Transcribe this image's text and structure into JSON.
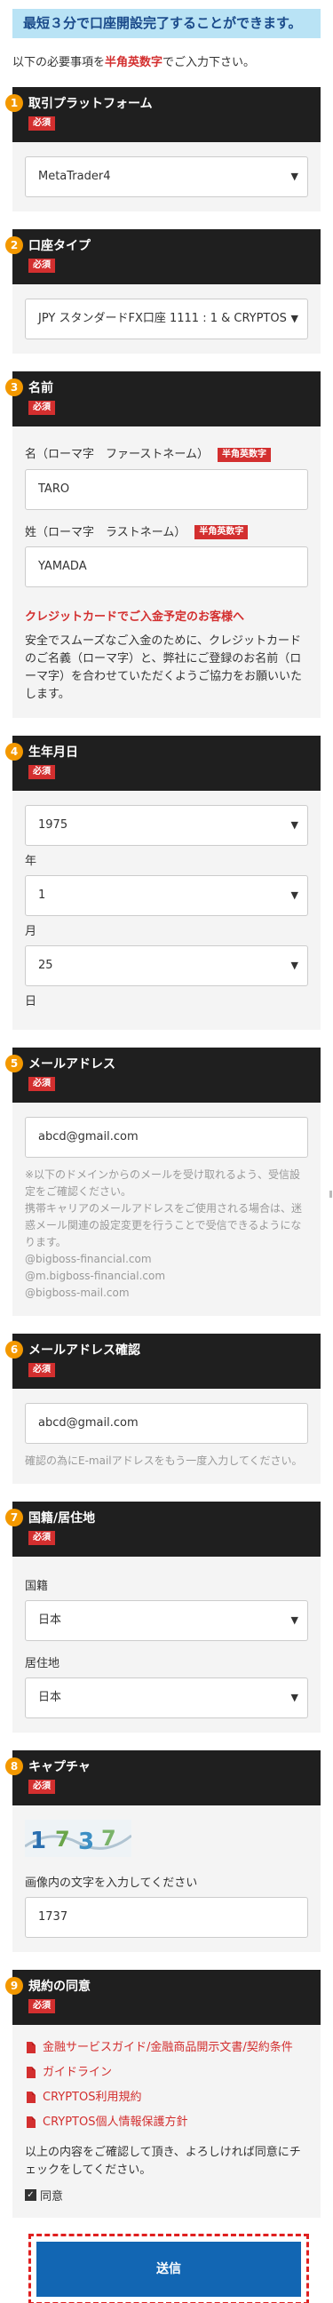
{
  "banner": "最短３分で口座開設完了することができます。",
  "intro": {
    "before": "以下の必要事項を",
    "highlight": "半角英数字",
    "after": "でご入力下さい。"
  },
  "required_label": "必須",
  "alnum_label": "半角英数字",
  "sections": {
    "platform": {
      "num": "1",
      "title": "取引プラットフォーム",
      "value": "MetaTrader4"
    },
    "account_type": {
      "num": "2",
      "title": "口座タイプ",
      "value": "JPY スタンダードFX口座 1111 : 1 & CRYPTOS"
    },
    "name": {
      "num": "3",
      "title": "名前",
      "first_label": "名（ローマ字　ファーストネーム）",
      "first_value": "TARO",
      "last_label": "姓（ローマ字　ラストネーム）",
      "last_value": "YAMADA",
      "card_heading": "クレジットカードでご入金予定のお客様へ",
      "card_note": "安全でスムーズなご入金のために、クレジットカードのご名義（ローマ字）と、弊社にご登録のお名前（ローマ字）を合わせていただくようご協力をお願いいたします。"
    },
    "birthday": {
      "num": "4",
      "title": "生年月日",
      "year": "1975",
      "year_label": "年",
      "month": "1",
      "month_label": "月",
      "day": "25",
      "day_label": "日"
    },
    "email": {
      "num": "5",
      "title": "メールアドレス",
      "value": "abcd@gmail.com",
      "note1": "※以下のドメインからのメールを受け取れるよう、受信設定をご確認ください。",
      "note2": "携帯キャリアのメールアドレスをご使用される場合は、迷惑メール関連の設定変更を行うことで受信できるようになります。",
      "domain1": "@bigboss-financial.com",
      "domain2": "@m.bigboss-financial.com",
      "domain3": "@bigboss-mail.com"
    },
    "email_confirm": {
      "num": "6",
      "title": "メールアドレス確認",
      "value": "abcd@gmail.com",
      "note": "確認の為にE-mailアドレスをもう一度入力してください。"
    },
    "nationality": {
      "num": "7",
      "title": "国籍/居住地",
      "nationality_label": "国籍",
      "nationality_value": "日本",
      "residence_label": "居住地",
      "residence_value": "日本"
    },
    "captcha": {
      "num": "8",
      "title": "キャプチャ",
      "instruction": "画像内の文字を入力してください",
      "value": "1737"
    },
    "agreement": {
      "num": "9",
      "title": "規約の同意",
      "links": [
        "金融サービスガイド/金融商品開示文書/契約条件",
        "ガイドライン",
        "CRYPTOS利用規約",
        "CRYPTOS個人情報保護方針"
      ],
      "text": "以上の内容をご確認して頂き、よろしければ同意にチェックをしてください。",
      "checkbox_label": "同意"
    }
  },
  "submit_label": "送信",
  "colors": {
    "accent_blue": "#1266b3",
    "required_red": "#d32f2f",
    "step_orange": "#f39800",
    "header_black": "#1f1f1f",
    "banner_blue": "#b9e3f5"
  }
}
